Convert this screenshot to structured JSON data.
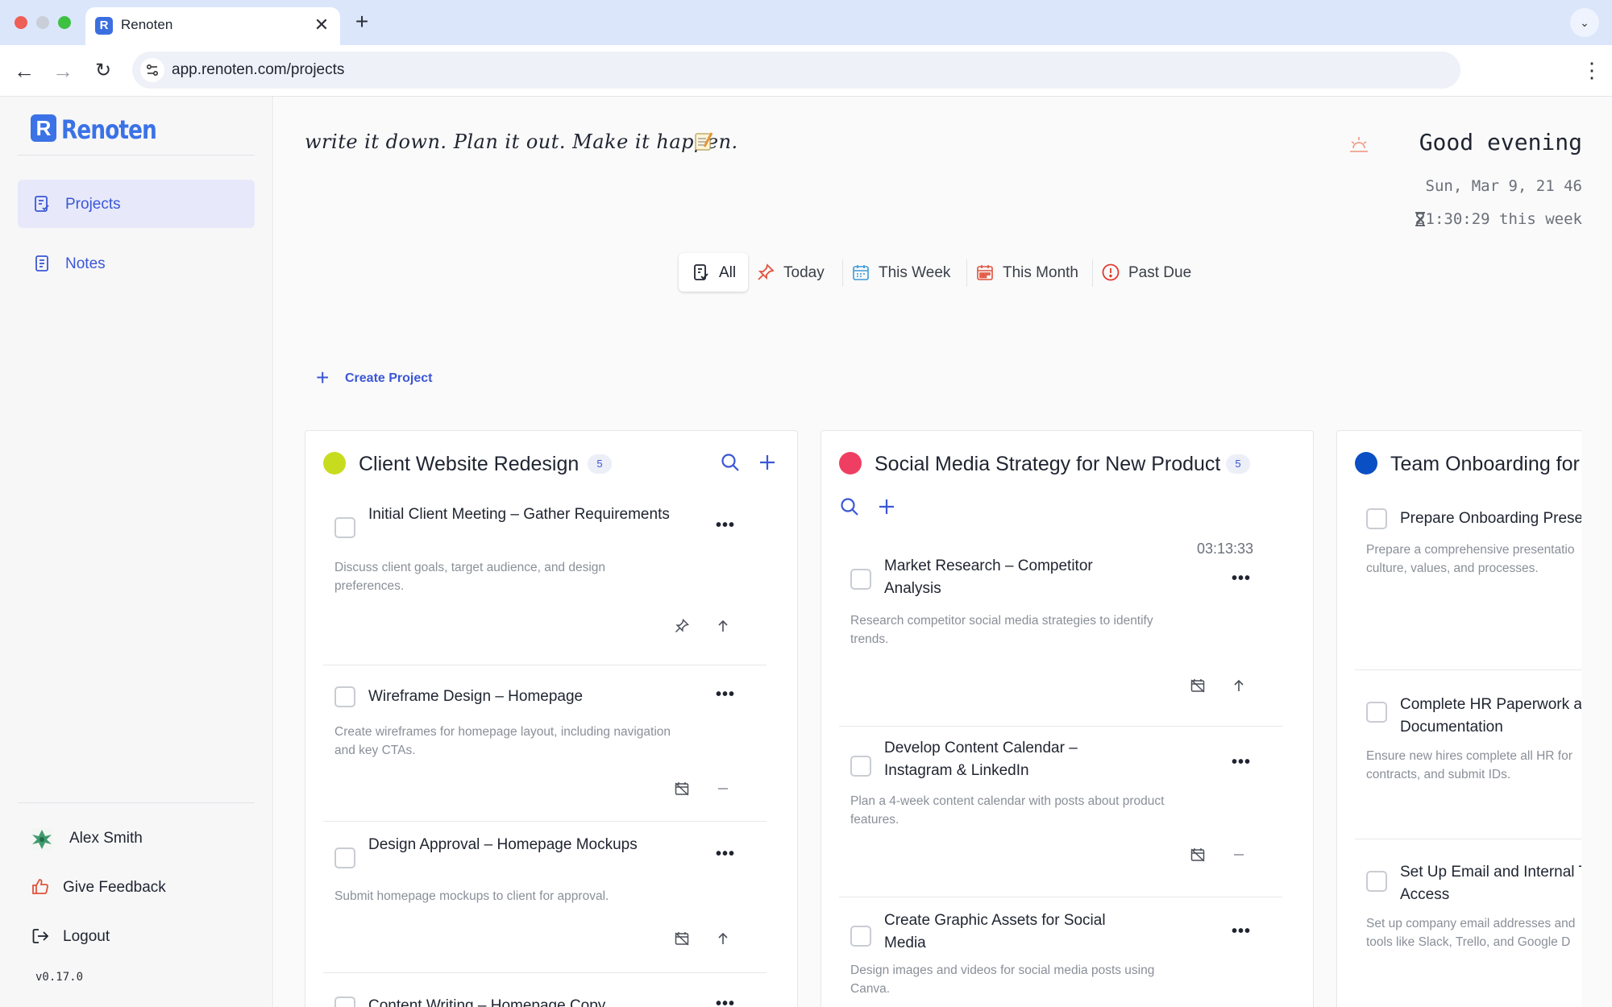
{
  "browser": {
    "tab_title": "Renoten",
    "url": "app.renoten.com/projects"
  },
  "sidebar": {
    "brand": "Renoten",
    "items": [
      {
        "label": "Projects",
        "active": true
      },
      {
        "label": "Notes",
        "active": false
      }
    ],
    "footer": {
      "user_name": "Alex Smith",
      "feedback": "Give Feedback",
      "logout": "Logout",
      "version": "v0.17.0"
    }
  },
  "header": {
    "tagline": "write it down. Plan it out. Make it happen.",
    "greeting": "Good evening",
    "date": "Sun, Mar 9, 21 46",
    "week_time": "21:30:29 this week"
  },
  "filters": [
    {
      "label": "All",
      "active": true,
      "icon": "clipboard-check-icon"
    },
    {
      "label": "Today",
      "active": false,
      "icon": "pin-icon"
    },
    {
      "label": "This Week",
      "active": false,
      "icon": "calendar-week-icon"
    },
    {
      "label": "This Month",
      "active": false,
      "icon": "calendar-month-icon"
    },
    {
      "label": "Past Due",
      "active": false,
      "icon": "alert-circle-icon"
    }
  ],
  "create_project": "Create Project",
  "colors": {
    "accent": "#3b57d6",
    "project1": "#c8dc1f",
    "project2": "#ee3f63",
    "project3": "#0b4fc4"
  },
  "projects": [
    {
      "title": "Client Website Redesign",
      "count": "5",
      "tasks": [
        {
          "title": "Initial Client Meeting – Gather Requirements",
          "desc": "Discuss client goals, target audience, and design preferences."
        },
        {
          "title": "Wireframe Design – Homepage",
          "desc": "Create wireframes for homepage layout, including navigation and key CTAs."
        },
        {
          "title": "Design Approval – Homepage Mockups",
          "desc": "Submit homepage mockups to client for approval."
        },
        {
          "title": "Content Writing – Homepage Copy",
          "desc": ""
        }
      ]
    },
    {
      "title": "Social Media Strategy for New Product",
      "count": "5",
      "tasks": [
        {
          "title": "Market Research – Competitor Analysis",
          "desc": "Research competitor social media strategies to identify trends.",
          "timer": "03:13:33"
        },
        {
          "title": "Develop Content Calendar – Instagram & LinkedIn",
          "desc": "Plan a 4-week content calendar with posts about product features."
        },
        {
          "title": "Create Graphic Assets for Social Media",
          "desc": "Design images and videos for social media posts using Canva."
        }
      ]
    },
    {
      "title": "Team Onboarding for",
      "tasks": [
        {
          "title": "Prepare Onboarding Prese",
          "desc": "Prepare a comprehensive presentatio culture, values, and processes."
        },
        {
          "title": "Complete HR Paperwork a Documentation",
          "desc": "Ensure new hires complete all HR for contracts, and submit IDs."
        },
        {
          "title": "Set Up Email and Internal T Access",
          "desc": "Set up company email addresses and tools like Slack, Trello, and Google D"
        }
      ]
    }
  ]
}
